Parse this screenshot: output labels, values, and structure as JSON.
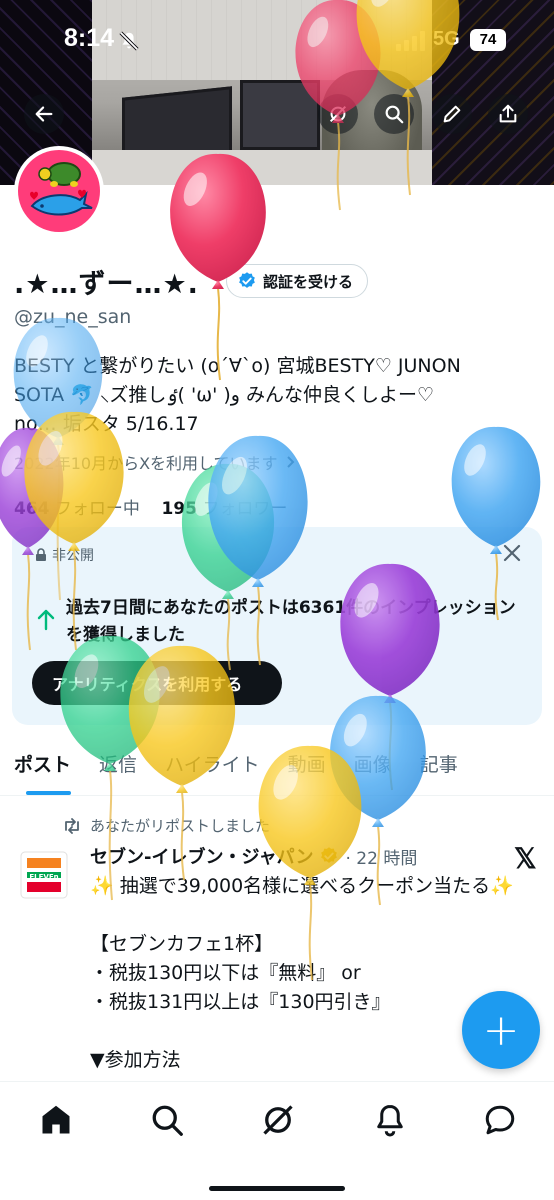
{
  "status_bar": {
    "time": "8:14",
    "network": "5G",
    "battery": "74"
  },
  "profile": {
    "display_name": ".★…ずー…★.",
    "verify_label": "認証を受ける",
    "handle": "@zu_ne_san",
    "bio_line1": "BESTY と繋がりたい (o´∀`o) 宮城BESTY♡ JUNON",
    "bio_line2": "SOTA 🐬 ⸜ズ推しٶ( 'ω' )ﻭ みんな仲良くしよー♡",
    "bio_line3": "no… 垢スタ 5/16.17",
    "joined": "2022年10月からXを利用しています",
    "following_count": "464",
    "following_label": "フォロー中",
    "followers_count": "195",
    "followers_label": "フォロワー"
  },
  "insight_card": {
    "label": "非公開",
    "message": "過去7日間にあなたのポストは6361件のインプレッションを獲得しました",
    "cta": "アナリティクスを利用する"
  },
  "tabs": [
    "ポスト",
    "返信",
    "ハイライト",
    "動画",
    "画像",
    "記事"
  ],
  "post": {
    "repost_label": "あなたがリポストしました",
    "author": "セブン‐イレブン・ジャパン",
    "time": "· 22 時間",
    "body": "✨ 抽選で39,000名様に選べるクーポン当たる✨\n\n【セブンカフェ1杯】\n・税抜130円以下は『無料』 or\n・税抜131円以上は『130円引き』\n\n▼参加方法",
    "avatar_text": "ELEVEn"
  },
  "colors": {
    "accent": "#1d9bf0",
    "text": "#0f1419",
    "muted": "#536471",
    "card_bg": "#eaf5fc"
  },
  "icons": [
    "back-arrow-icon",
    "grok-icon",
    "search-icon",
    "edit-icon",
    "share-icon",
    "verified-badge-icon",
    "chevron-right-icon",
    "close-icon",
    "repost-icon",
    "x-logo-icon",
    "home-icon",
    "search-nav-icon",
    "grok-nav-icon",
    "notifications-icon",
    "messages-icon"
  ]
}
